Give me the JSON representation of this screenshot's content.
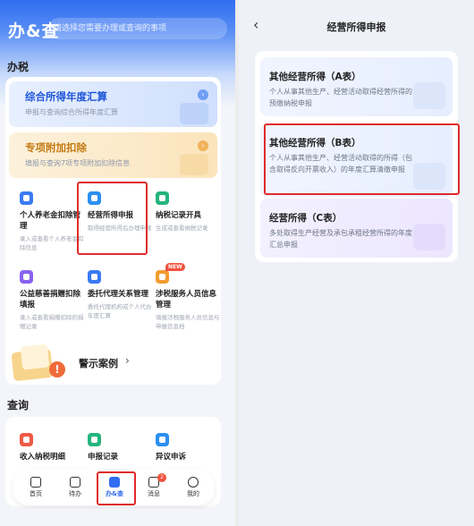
{
  "left": {
    "header": {
      "title": "办&查",
      "search_placeholder": "请选择您需要办理或查询的事项"
    },
    "section_tax": {
      "title": "办税"
    },
    "banner_annual": {
      "title": "综合所得年度汇算",
      "subtitle": "申报与查询综合所得年度汇算"
    },
    "banner_special": {
      "title": "专项附加扣除",
      "subtitle": "填报与查询7项专项附加扣除信息"
    },
    "grid": [
      {
        "name": "个人养老金扣除管理",
        "desc": "录入或查看个人养老金扣除信息"
      },
      {
        "name": "经营所得申报",
        "desc": "取得经营所得后办理申报"
      },
      {
        "name": "纳税记录开具",
        "desc": "生成或查看纳税记录"
      },
      {
        "name": "公益慈善捐赠扣除填报",
        "desc": "录入或查看捐赠扣除的捐赠记录"
      },
      {
        "name": "委托代理关系管理",
        "desc": "委托代理机构或个人代办年度汇算"
      },
      {
        "name": "涉税服务人员信息管理",
        "desc": "填报涉税服务人员信息与申报信息档",
        "badge": "NEW"
      }
    ],
    "case": {
      "label": "警示案例",
      "arrow": "›",
      "alert": "!"
    },
    "section_query": {
      "title": "查询"
    },
    "query_grid": [
      {
        "name": "收入纳税明细"
      },
      {
        "name": "申报记录"
      },
      {
        "name": "异议申诉"
      }
    ],
    "tabbar": [
      {
        "label": "首页",
        "active": false
      },
      {
        "label": "待办",
        "active": false
      },
      {
        "label": "办&查",
        "active": true
      },
      {
        "label": "消息",
        "active": false,
        "badge": "2"
      },
      {
        "label": "我的",
        "active": false
      }
    ]
  },
  "right": {
    "title": "经营所得申报",
    "back": "‹",
    "cards": [
      {
        "title": "其他经营所得（A表）",
        "desc": "个人从事其他生产、经营活动取得经营所得的预缴纳税申报"
      },
      {
        "title": "其他经营所得（B表）",
        "desc": "个人从事其他生产、经营活动取得的所得（包含取得反向开票收入）的年度汇算清缴申报"
      },
      {
        "title": "经营所得（C表）",
        "desc": "多处取得生产经营及承包承租经营所得的年度汇总申报"
      }
    ]
  },
  "colors": {
    "primary": "#2f6df0",
    "highlight": "#e02b2b"
  }
}
